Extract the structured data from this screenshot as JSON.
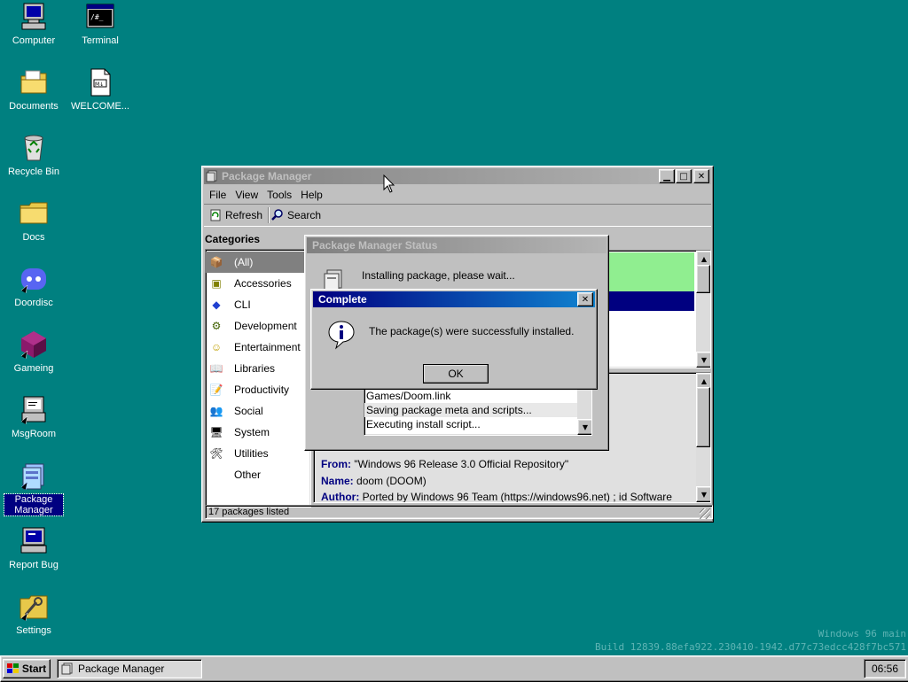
{
  "desktop": {
    "icons": [
      {
        "label": "Computer",
        "icon": "computer-icon"
      },
      {
        "label": "Terminal",
        "icon": "terminal-icon"
      },
      {
        "label": "Documents",
        "icon": "documents-folder-icon"
      },
      {
        "label": "WELCOME...",
        "icon": "markdown-file-icon"
      },
      {
        "label": "Recycle Bin",
        "icon": "recycle-bin-icon"
      },
      {
        "label": "Docs",
        "icon": "folder-icon"
      },
      {
        "label": "Doordisc",
        "icon": "doordisc-icon"
      },
      {
        "label": "Gameing",
        "icon": "gameing-icon"
      },
      {
        "label": "MsgRoom",
        "icon": "msgroom-icon"
      },
      {
        "label": "Package Manager",
        "icon": "package-manager-icon"
      },
      {
        "label": "Report Bug",
        "icon": "report-bug-icon"
      },
      {
        "label": "Settings",
        "icon": "settings-icon"
      }
    ],
    "watermark": {
      "line1": "Windows 96 main",
      "line2": "Build 12839.88efa922.230410-1942.d77c73edcc428f7bc571"
    }
  },
  "package_manager": {
    "title": "Package Manager",
    "menu": [
      "File",
      "View",
      "Tools",
      "Help"
    ],
    "toolbar": {
      "refresh": "Refresh",
      "search": "Search"
    },
    "categories_header": "Categories",
    "categories": [
      "(All)",
      "Accessories",
      "CLI",
      "Development",
      "Entertainment",
      "Libraries",
      "Productivity",
      "Social",
      "System",
      "Utilities",
      "Other"
    ],
    "details": {
      "from_label": "From:",
      "from_value": "\"Windows 96 Release 3.0 Official Repository\"",
      "name_label": "Name:",
      "name_value": "doom (DOOM)",
      "author_label": "Author:",
      "author_value": "Ported by Windows 96 Team (https://windows96.net) ; id Software"
    },
    "status": "17 packages listed"
  },
  "status_dialog": {
    "title": "Package Manager Status",
    "message": "Installing package, please wait...",
    "log": [
      "Games/Doom.link",
      "Saving package meta and scripts...",
      "Executing install script..."
    ]
  },
  "complete_dialog": {
    "title": "Complete",
    "message": "The package(s) were successfully installed.",
    "ok": "OK"
  },
  "taskbar": {
    "start": "Start",
    "task": "Package Manager",
    "clock": "06:56"
  }
}
